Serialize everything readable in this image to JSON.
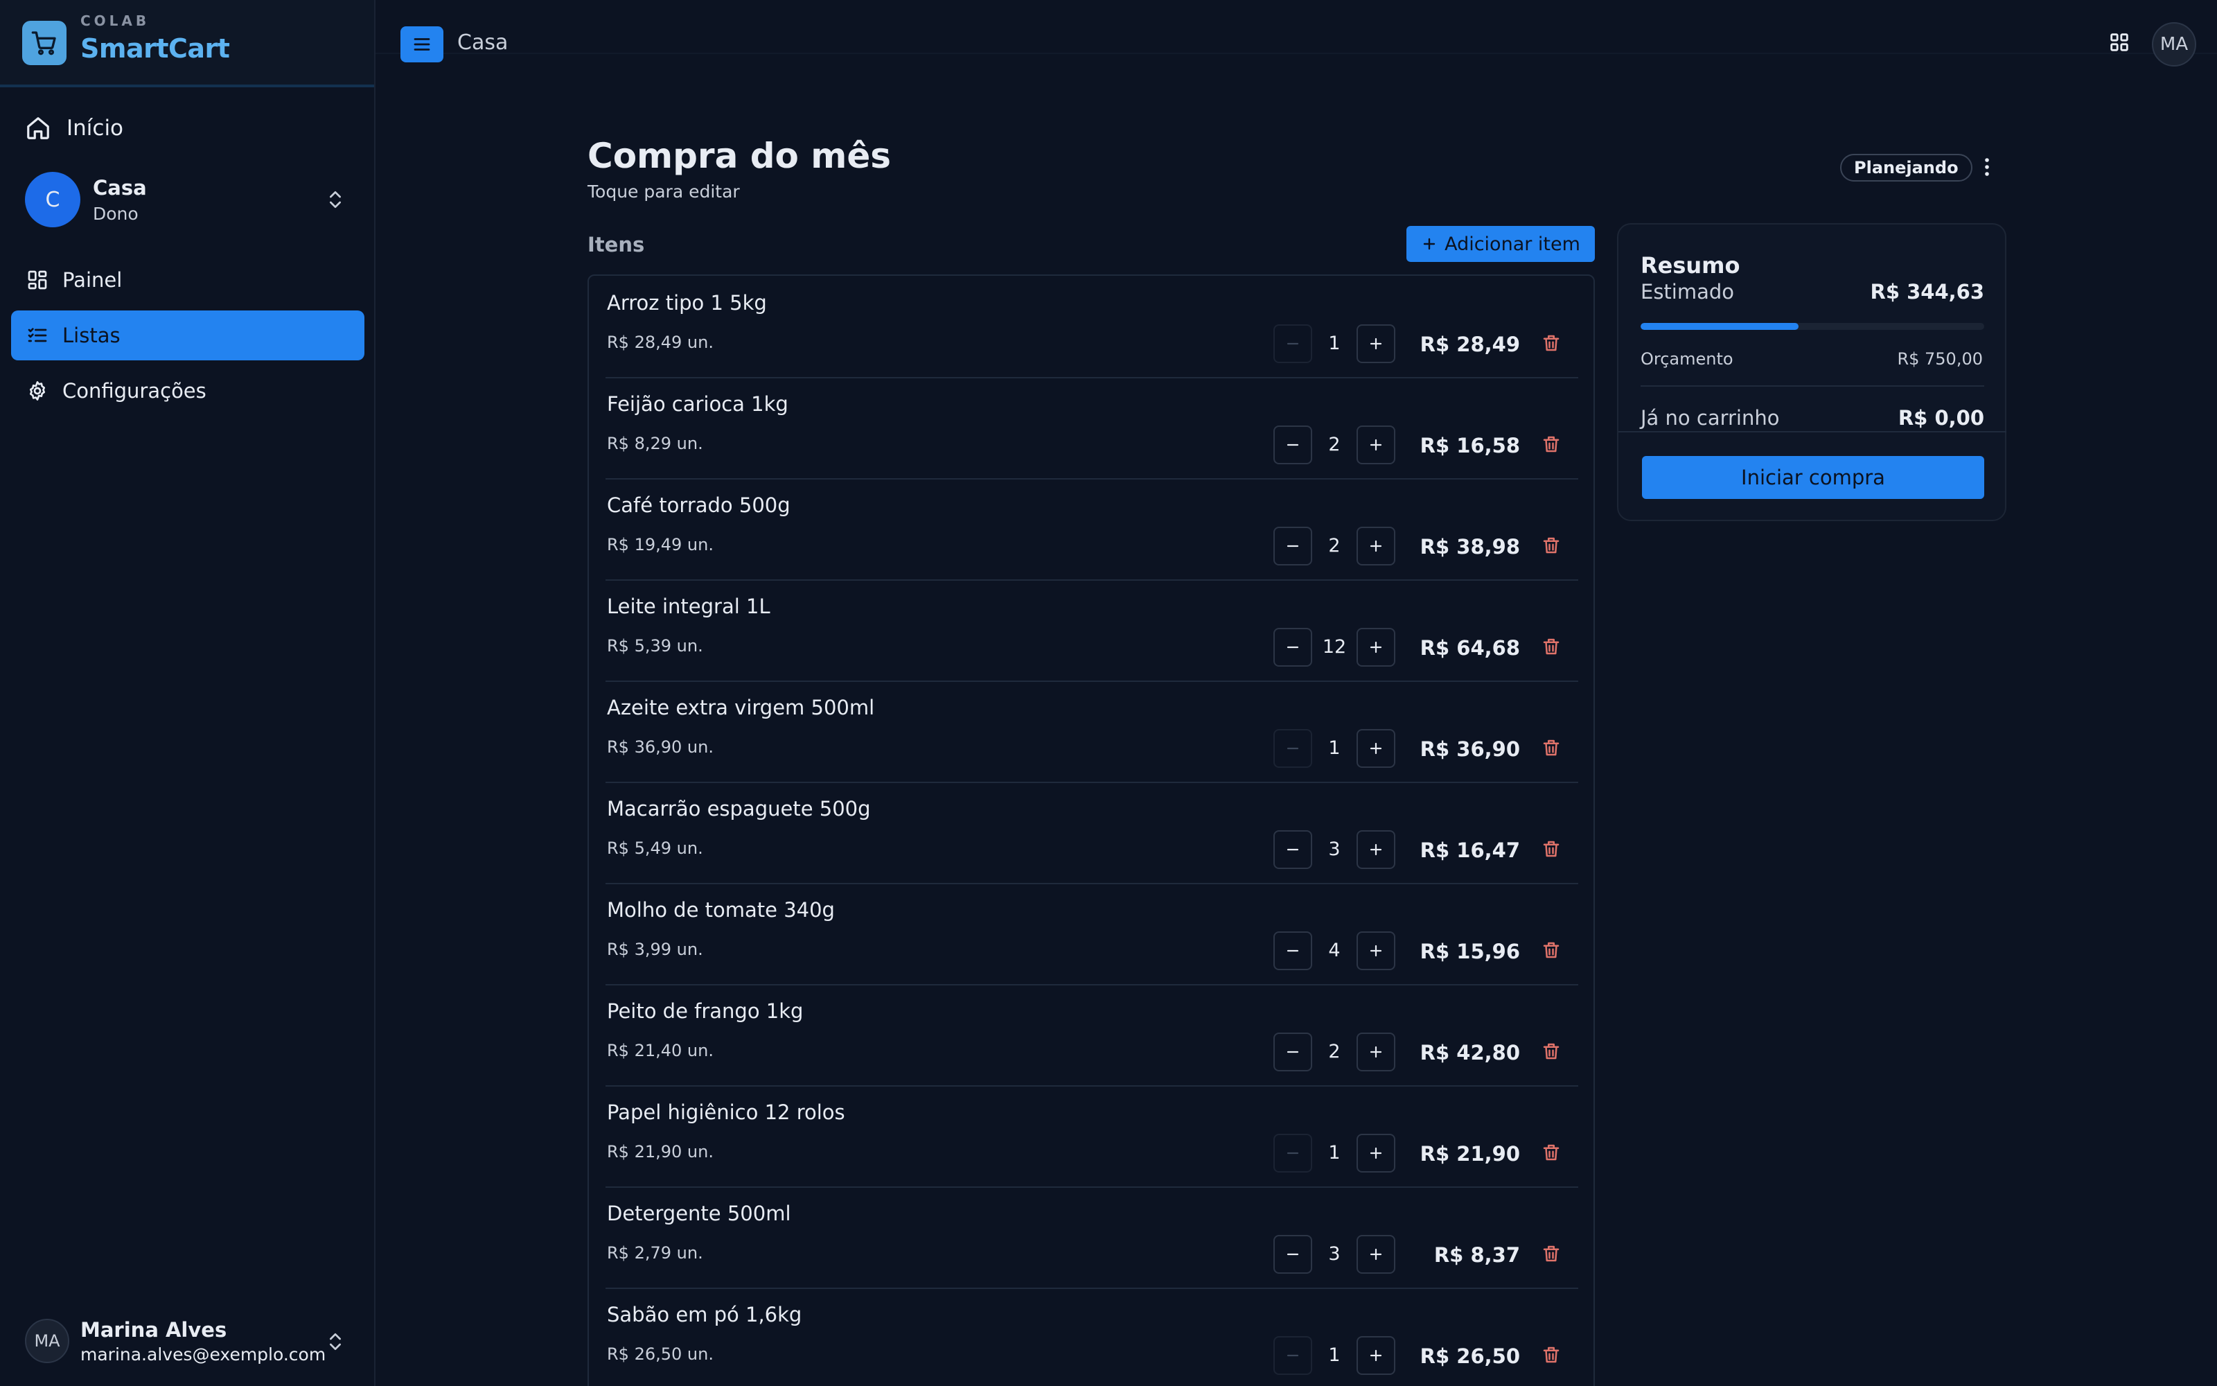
{
  "app": {
    "brand_small": "COLAB",
    "brand_name": "SmartCart"
  },
  "sidebar": {
    "home_label": "Início",
    "workspace": {
      "initial": "C",
      "name": "Casa",
      "role": "Dono"
    },
    "items": [
      {
        "label": "Painel",
        "icon": "dashboard-icon",
        "active": false
      },
      {
        "label": "Listas",
        "icon": "list-checks-icon",
        "active": true
      },
      {
        "label": "Configurações",
        "icon": "gear-icon",
        "active": false
      }
    ],
    "user": {
      "initials": "MA",
      "name": "Marina Alves",
      "email": "marina.alves@exemplo.com"
    }
  },
  "topbar": {
    "title": "Casa",
    "avatar_initials": "MA"
  },
  "list": {
    "title": "Compra do mês",
    "subtitle": "Toque para editar",
    "status": "Planejando",
    "items_label": "Itens",
    "add_label": "Adicionar item",
    "items": [
      {
        "name": "Arroz tipo 1 5kg",
        "unit_price": "R$ 28,49 un.",
        "qty": "1",
        "total": "R$ 28,49",
        "dec_disabled": true
      },
      {
        "name": "Feijão carioca 1kg",
        "unit_price": "R$ 8,29 un.",
        "qty": "2",
        "total": "R$ 16,58",
        "dec_disabled": false
      },
      {
        "name": "Café torrado 500g",
        "unit_price": "R$ 19,49 un.",
        "qty": "2",
        "total": "R$ 38,98",
        "dec_disabled": false
      },
      {
        "name": "Leite integral 1L",
        "unit_price": "R$ 5,39 un.",
        "qty": "12",
        "total": "R$ 64,68",
        "dec_disabled": false
      },
      {
        "name": "Azeite extra virgem 500ml",
        "unit_price": "R$ 36,90 un.",
        "qty": "1",
        "total": "R$ 36,90",
        "dec_disabled": true
      },
      {
        "name": "Macarrão espaguete 500g",
        "unit_price": "R$ 5,49 un.",
        "qty": "3",
        "total": "R$ 16,47",
        "dec_disabled": false
      },
      {
        "name": "Molho de tomate 340g",
        "unit_price": "R$ 3,99 un.",
        "qty": "4",
        "total": "R$ 15,96",
        "dec_disabled": false
      },
      {
        "name": "Peito de frango 1kg",
        "unit_price": "R$ 21,40 un.",
        "qty": "2",
        "total": "R$ 42,80",
        "dec_disabled": false
      },
      {
        "name": "Papel higiênico 12 rolos",
        "unit_price": "R$ 21,90 un.",
        "qty": "1",
        "total": "R$ 21,90",
        "dec_disabled": true
      },
      {
        "name": "Detergente 500ml",
        "unit_price": "R$ 2,79 un.",
        "qty": "3",
        "total": "R$ 8,37",
        "dec_disabled": false
      },
      {
        "name": "Sabão em pó 1,6kg",
        "unit_price": "R$ 26,50 un.",
        "qty": "1",
        "total": "R$ 26,50",
        "dec_disabled": true
      }
    ]
  },
  "summary": {
    "title": "Resumo",
    "estimated_label": "Estimado",
    "estimated_value": "R$ 344,63",
    "budget_progress": 0.46,
    "budget_label": "Orçamento",
    "budget_value": "R$ 750,00",
    "cart_label": "Já no carrinho",
    "cart_value": "R$ 0,00",
    "start_label": "Iniciar compra"
  },
  "colors": {
    "accent": "#2383f0",
    "brand": "#5cb2f0",
    "danger": "#e0736a",
    "background": "#0c1322"
  }
}
